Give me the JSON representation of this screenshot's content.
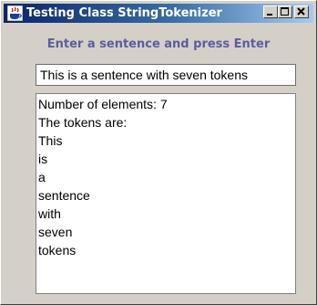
{
  "window": {
    "title": "Testing Class StringTokenizer",
    "icons": {
      "app": "java-coffee-cup-icon",
      "minimize": "minimize-icon",
      "maximize": "maximize-icon",
      "close": "close-icon"
    }
  },
  "prompt": {
    "label": "Enter a sentence and press Enter"
  },
  "input": {
    "value": "This is a sentence with seven tokens"
  },
  "output": {
    "lines": [
      "Number of elements: 7",
      "The tokens are:",
      "This",
      "is",
      "a",
      "sentence",
      "with",
      "seven",
      "tokens"
    ]
  },
  "colors": {
    "titlebar_start": "#0a246a",
    "titlebar_end": "#a6caf0",
    "window_bg": "#d4d0c8",
    "prompt_text": "#5c5ca0"
  }
}
